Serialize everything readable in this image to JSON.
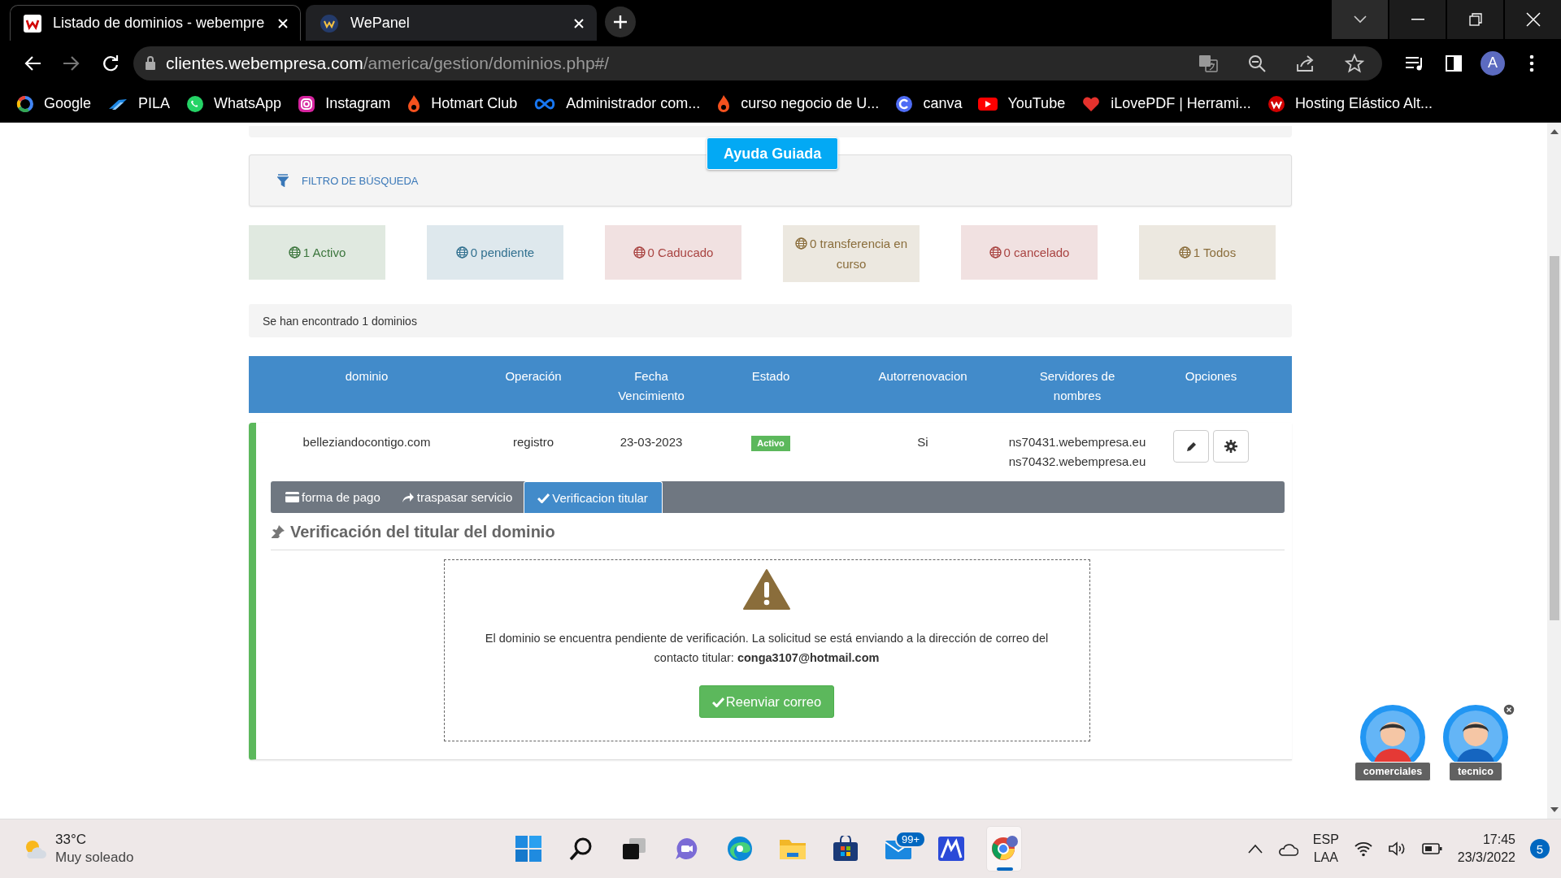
{
  "browser": {
    "tabs": [
      {
        "title": "Listado de dominios - webempre",
        "selected": true
      },
      {
        "title": "WePanel",
        "selected": false
      }
    ],
    "toolbar": {
      "forward_enabled": false,
      "url_host": "clientes.webempresa.com",
      "url_path": "/america/gestion/dominios.php#/",
      "profile_initial": "A"
    },
    "bookmarks": [
      {
        "label": "Google"
      },
      {
        "label": "PILA"
      },
      {
        "label": "WhatsApp"
      },
      {
        "label": "Instagram"
      },
      {
        "label": "Hotmart Club"
      },
      {
        "label": "Administrador com..."
      },
      {
        "label": "curso negocio de U..."
      },
      {
        "label": "canva"
      },
      {
        "label": "YouTube"
      },
      {
        "label": "iLovePDF | Herrami..."
      },
      {
        "label": "Hosting Elástico Alt..."
      }
    ]
  },
  "page": {
    "help_button": "Ayuda Guiada",
    "filter_label": "FILTRO DE BÚSQUEDA",
    "status_cards": [
      {
        "text": "1 Activo",
        "color": "#3c763d"
      },
      {
        "text": "0 pendiente",
        "color": "#31708f"
      },
      {
        "text": "0 Caducado",
        "color": "#a94442"
      },
      {
        "text": "0 transferencia en curso",
        "color": "#8a6d3b"
      },
      {
        "text": "0 cancelado",
        "color": "#a94442"
      },
      {
        "text": "1 Todos",
        "color": "#8a6d3b"
      }
    ],
    "results_text": "Se han encontrado 1 dominios",
    "table": {
      "columns": [
        "dominio",
        "Operación",
        "Fecha Vencimiento",
        "Estado",
        "Autorrenovacion",
        "Servidores de nombres",
        "Opciones"
      ],
      "rows": [
        {
          "domain": "belleziandocontigo.com",
          "operation": "registro",
          "expiry": "23-03-2023",
          "status": "Activo",
          "autorenew": "Si",
          "nameservers": [
            "ns70431.webempresa.eu",
            "ns70432.webempresa.eu"
          ]
        }
      ]
    },
    "detail_tabs": [
      {
        "label": "forma de pago",
        "selected": false
      },
      {
        "label": "traspasar servicio",
        "selected": false
      },
      {
        "label": "Verificacion titular",
        "selected": true
      }
    ],
    "section_title": "Verificación del titular del dominio",
    "notice": "El dominio se encuentra pendiente de verificación. La solicitud se está enviando a la dirección de correo del contacto titular: **conga3107@hotmail.com**",
    "resend_button": "Reenviar correo"
  },
  "chat_widgets": [
    {
      "label": "comerciales",
      "closable": false
    },
    {
      "label": "tecnico",
      "closable": true
    }
  ],
  "taskbar": {
    "weather": {
      "temp": "33°C",
      "desc": "Muy soleado"
    },
    "mail_badge": "99+",
    "language": [
      "ESP",
      "LAA"
    ],
    "time": "17:45",
    "date": "23/3/2022",
    "notifications": "5"
  }
}
